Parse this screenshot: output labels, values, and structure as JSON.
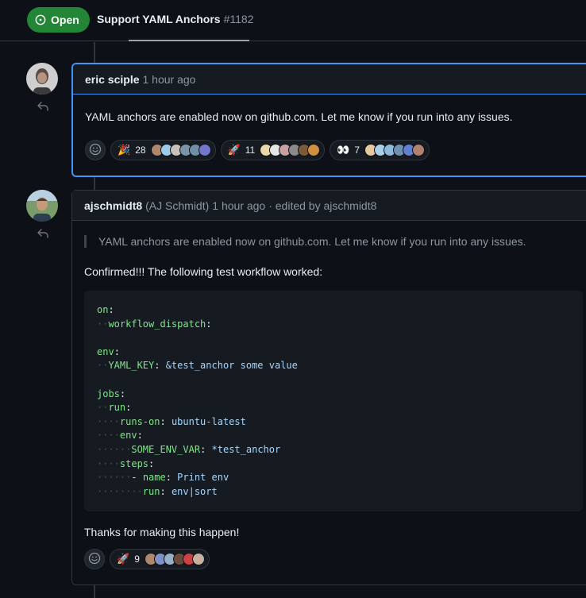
{
  "issue": {
    "status_label": "Open",
    "title": "Support YAML Anchors",
    "number": "#1182"
  },
  "comments": [
    {
      "author": "eric sciple",
      "timestamp": "1 hour ago",
      "body": "YAML anchors are enabled now on github.com. Let me know if you run into any issues.",
      "reactions": [
        {
          "emoji": "🎉",
          "count": "28"
        },
        {
          "emoji": "🚀",
          "count": "11"
        },
        {
          "emoji": "👀",
          "count": "7"
        }
      ]
    },
    {
      "author": "ajschmidt8",
      "author_fullname": "(AJ Schmidt)",
      "timestamp": "1 hour ago",
      "edited": "· edited by ajschmidt8",
      "quote": "YAML anchors are enabled now on github.com. Let me know if you run into any issues.",
      "intro": "Confirmed!!! The following test workflow worked:",
      "code": {
        "l1_key": "on",
        "l2_key": "workflow_dispatch",
        "l4_key": "env",
        "l5_key": "YAML_KEY",
        "l5_val": "&test_anchor some value",
        "l7_key": "jobs",
        "l8_key": "run",
        "l9_key": "runs-on",
        "l9_val": "ubuntu-latest",
        "l10_key": "env",
        "l11_key": "SOME_ENV_VAR",
        "l11_val": "*test_anchor",
        "l12_key": "steps",
        "l13_key": "name",
        "l13_val": "Print env",
        "l14_key": "run",
        "l14_val": "env|sort"
      },
      "outro": "Thanks for making this happen!",
      "reactions": [
        {
          "emoji": "🚀",
          "count": "9"
        }
      ]
    }
  ],
  "colors": {
    "open_green": "#238636",
    "highlight_blue": "#4493f8",
    "yaml_key": "#7ee787",
    "yaml_value": "#a5d6ff"
  },
  "icons": [
    "issue-open-icon",
    "reply-arrow-icon",
    "smiley-icon"
  ]
}
